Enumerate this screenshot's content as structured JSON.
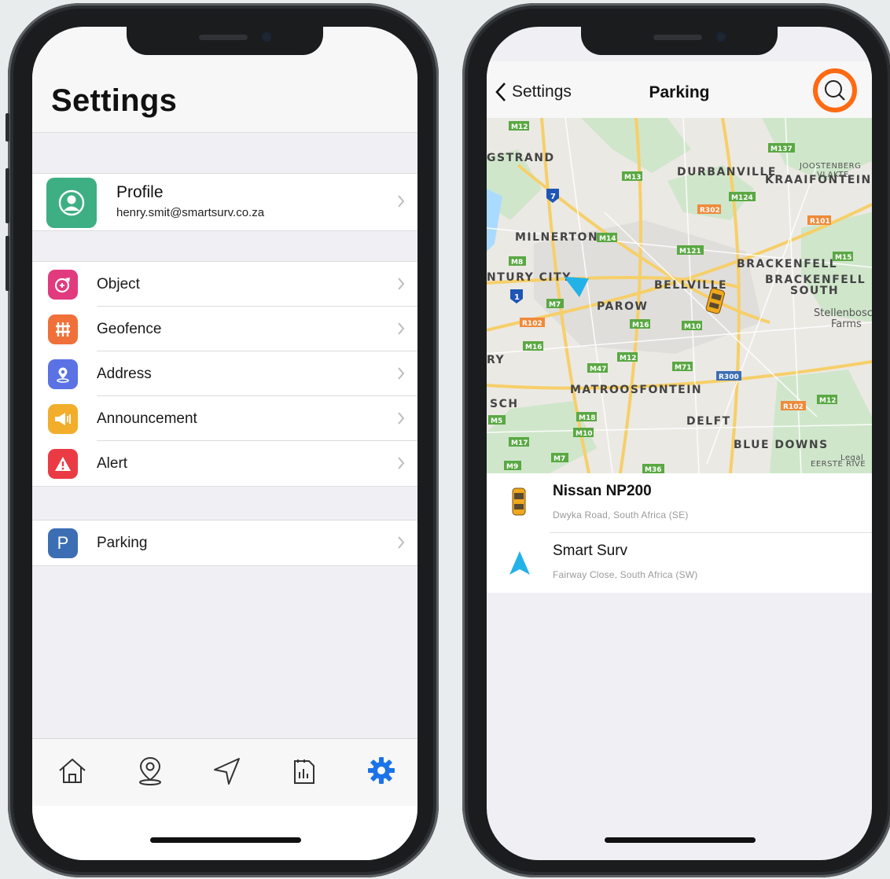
{
  "settings_screen": {
    "title": "Settings",
    "profile": {
      "name": "Profile",
      "email": "henry.smit@smartsurv.co.za",
      "icon": "user-avatar-icon"
    },
    "items": [
      {
        "label": "Object",
        "icon": "object-icon",
        "color": "#e13a7f"
      },
      {
        "label": "Geofence",
        "icon": "geofence-icon",
        "color": "#f0703a"
      },
      {
        "label": "Address",
        "icon": "address-pin-icon",
        "color": "#5a72e4"
      },
      {
        "label": "Announcement",
        "icon": "megaphone-icon",
        "color": "#f2ae2b"
      },
      {
        "label": "Alert",
        "icon": "alert-triangle-icon",
        "color": "#ea3b44"
      }
    ],
    "parking": {
      "label": "Parking",
      "icon_letter": "P",
      "color": "#3c6eb3"
    },
    "tabbar": {
      "tabs": [
        "home-icon",
        "location-pin-icon",
        "navigation-arrow-icon",
        "report-icon",
        "settings-gear-icon"
      ],
      "active_tab": "settings-gear-icon",
      "active_color": "#1a73e8"
    }
  },
  "parking_screen": {
    "back_label": "Settings",
    "title": "Parking",
    "search_highlight_color": "#ff6a13",
    "map": {
      "places": [
        "GSTRAND",
        "DURBANVILLE",
        "JOOSTENBERG",
        "VLAKTE",
        "KRAAIFONTEIN",
        "MILNERTON",
        "BRACKENFELL",
        "BRACKENFELL",
        "SOUTH",
        "NTURY CITY",
        "BELLVILLE",
        "PAROW",
        "Stellenbosc",
        "Farms",
        "RY",
        "MATROOSFONTEIN",
        "SCH",
        "DELFT",
        "BLUE DOWNS",
        "EERSTE RIVE",
        "Legal"
      ],
      "routes": [
        "M12",
        "M137",
        "M13",
        "M124",
        "R302",
        "R101",
        "M14",
        "M121",
        "M15",
        "M8",
        "M7",
        "R102",
        "M16",
        "M10",
        "M16",
        "M12",
        "M47",
        "M71",
        "R300",
        "M18",
        "M5",
        "M10",
        "R102",
        "M12",
        "M17",
        "M7",
        "M9",
        "M36"
      ],
      "highway_numbers": [
        "7",
        "1"
      ]
    },
    "vehicles": [
      {
        "name": "Nissan NP200",
        "address": "Dwyka Road, South Africa (SE)",
        "icon": "yellow-car-icon"
      },
      {
        "name": "Smart Surv",
        "address": "Fairway Close, South Africa (SW)",
        "icon": "navigation-arrow-icon"
      }
    ]
  }
}
